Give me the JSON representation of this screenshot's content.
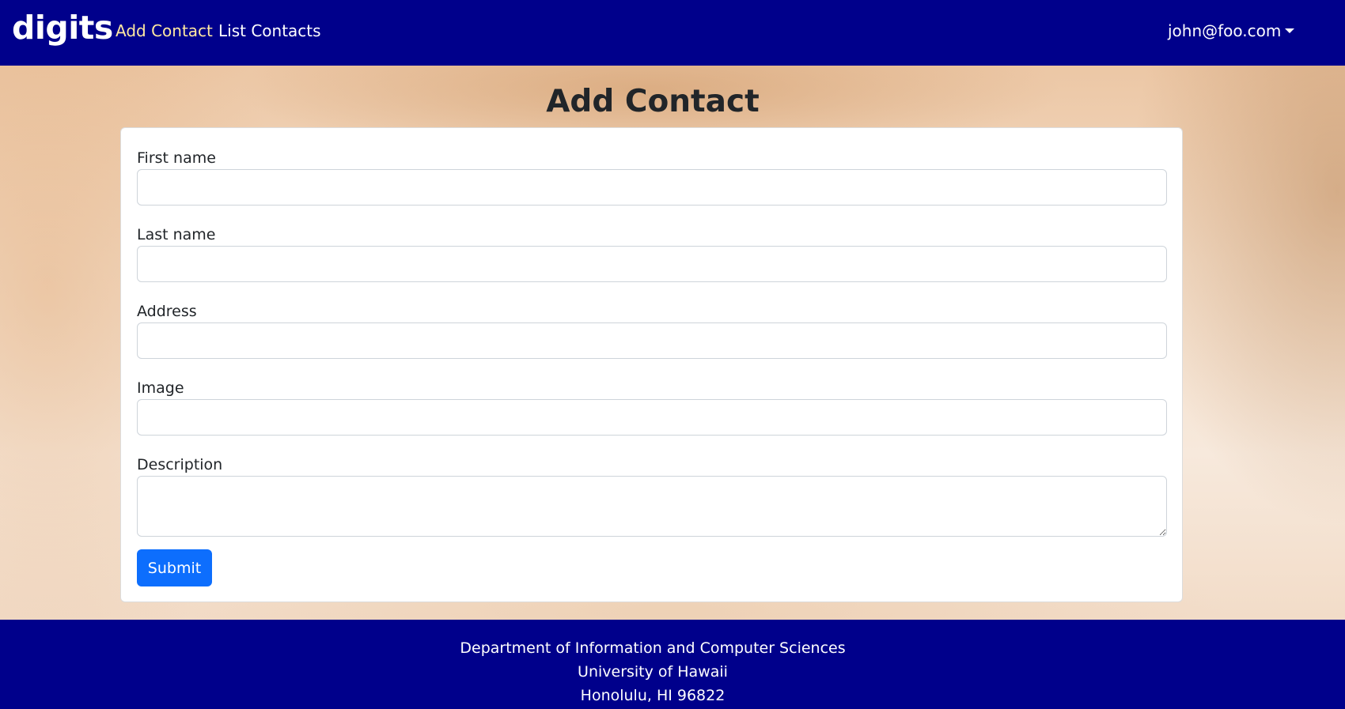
{
  "navbar": {
    "brand": "digits",
    "links": [
      {
        "label": "Add Contact",
        "active": true
      },
      {
        "label": "List Contacts",
        "active": false
      }
    ],
    "user": "john@foo.com"
  },
  "main": {
    "title": "Add Contact",
    "form": {
      "fields": [
        {
          "label": "First name",
          "value": ""
        },
        {
          "label": "Last name",
          "value": ""
        },
        {
          "label": "Address",
          "value": ""
        },
        {
          "label": "Image",
          "value": ""
        },
        {
          "label": "Description",
          "value": ""
        }
      ],
      "submit_label": "Submit"
    }
  },
  "footer": {
    "lines": [
      "Department of Information and Computer Sciences",
      "University of Hawaii",
      "Honolulu, HI 96822"
    ]
  },
  "colors": {
    "navbar_bg": "#00008b",
    "active_link": "#ffe9a1",
    "primary_button": "#0d6efd"
  }
}
